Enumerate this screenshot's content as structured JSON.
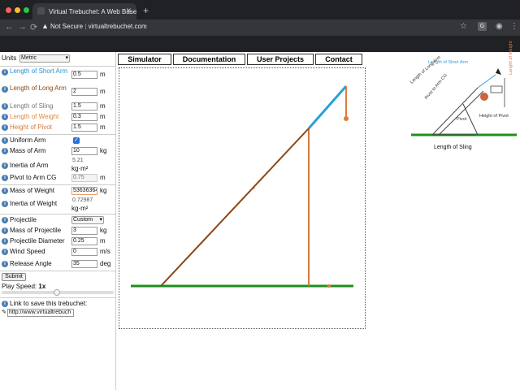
{
  "browser": {
    "tab_title": "Virtual Trebuchet: A Web Base",
    "security_label": "Not Secure",
    "url": "virtualtrebuchet.com",
    "extension_badge": "G"
  },
  "nav": {
    "tabs": [
      {
        "label": "Simulator"
      },
      {
        "label": "Documentation"
      },
      {
        "label": "User Projects"
      },
      {
        "label": "Contact"
      }
    ]
  },
  "form": {
    "units_label": "Units",
    "units_value": "Metric",
    "fields": [
      {
        "label": "Length of Short Arm",
        "value": "0.5",
        "unit": "m",
        "color": "#2a8fd0"
      },
      {
        "label": "Length of Long Arm",
        "value": "2",
        "unit": "m",
        "color": "#8b4513"
      },
      {
        "label": "Length of Sling",
        "value": "1.5",
        "unit": "m",
        "color": "#777777"
      },
      {
        "label": "Length of Weight",
        "value": "0.3",
        "unit": "m",
        "color": "#e08a3c"
      },
      {
        "label": "Height of Pivot",
        "value": "1.5",
        "unit": "m",
        "color": "#d2783c"
      }
    ],
    "uniform_arm_label": "Uniform Arm",
    "mass_of_arm": {
      "label": "Mass of Arm",
      "value": "10",
      "unit": "kg"
    },
    "inertia_of_arm": {
      "label": "Inertia of Arm",
      "value": "5.21",
      "unit": "kg·m²"
    },
    "pivot_to_arm_cg": {
      "label": "Pivot to Arm CG",
      "value": "0.75",
      "unit": "m"
    },
    "mass_of_weight": {
      "label": "Mass of Weight",
      "value": "53636364",
      "unit": "kg"
    },
    "inertia_of_weight": {
      "label": "Inertia of Weight",
      "value": "0.72987",
      "unit": "kg·m²"
    },
    "projectile": {
      "label": "Projectile",
      "value": "Custom"
    },
    "mass_of_projectile": {
      "label": "Mass of Projectile",
      "value": "3",
      "unit": "kg"
    },
    "projectile_diameter": {
      "label": "Projectile Diameter",
      "value": "0.25",
      "unit": "m"
    },
    "wind_speed": {
      "label": "Wind Speed",
      "value": "0",
      "unit": "m/s"
    },
    "release_angle": {
      "label": "Release Angle",
      "value": "35",
      "unit": "deg"
    },
    "submit_label": "Submit",
    "play_speed_label": "Play Speed:",
    "play_speed_value": "1x",
    "save_link_label": "Link to save this trebuchet:",
    "save_link_value": "http://www.virtualtrebuch"
  },
  "diagram": {
    "labels": {
      "short_arm": "Length of Short Arm",
      "long_arm": "Length of Long Arm",
      "weight": "Length of Weight",
      "pivot_cg": "Pivot to Arm CG",
      "pivot": "Pivot",
      "height_pivot": "Height of Pivot",
      "sling": "Length of Sling"
    }
  },
  "colors": {
    "short_arm": "#2a9fd6",
    "long_arm": "#8b4513",
    "weight": "#e07b39",
    "ground": "#1e8f1e",
    "pivot_post": "#d2783c"
  }
}
